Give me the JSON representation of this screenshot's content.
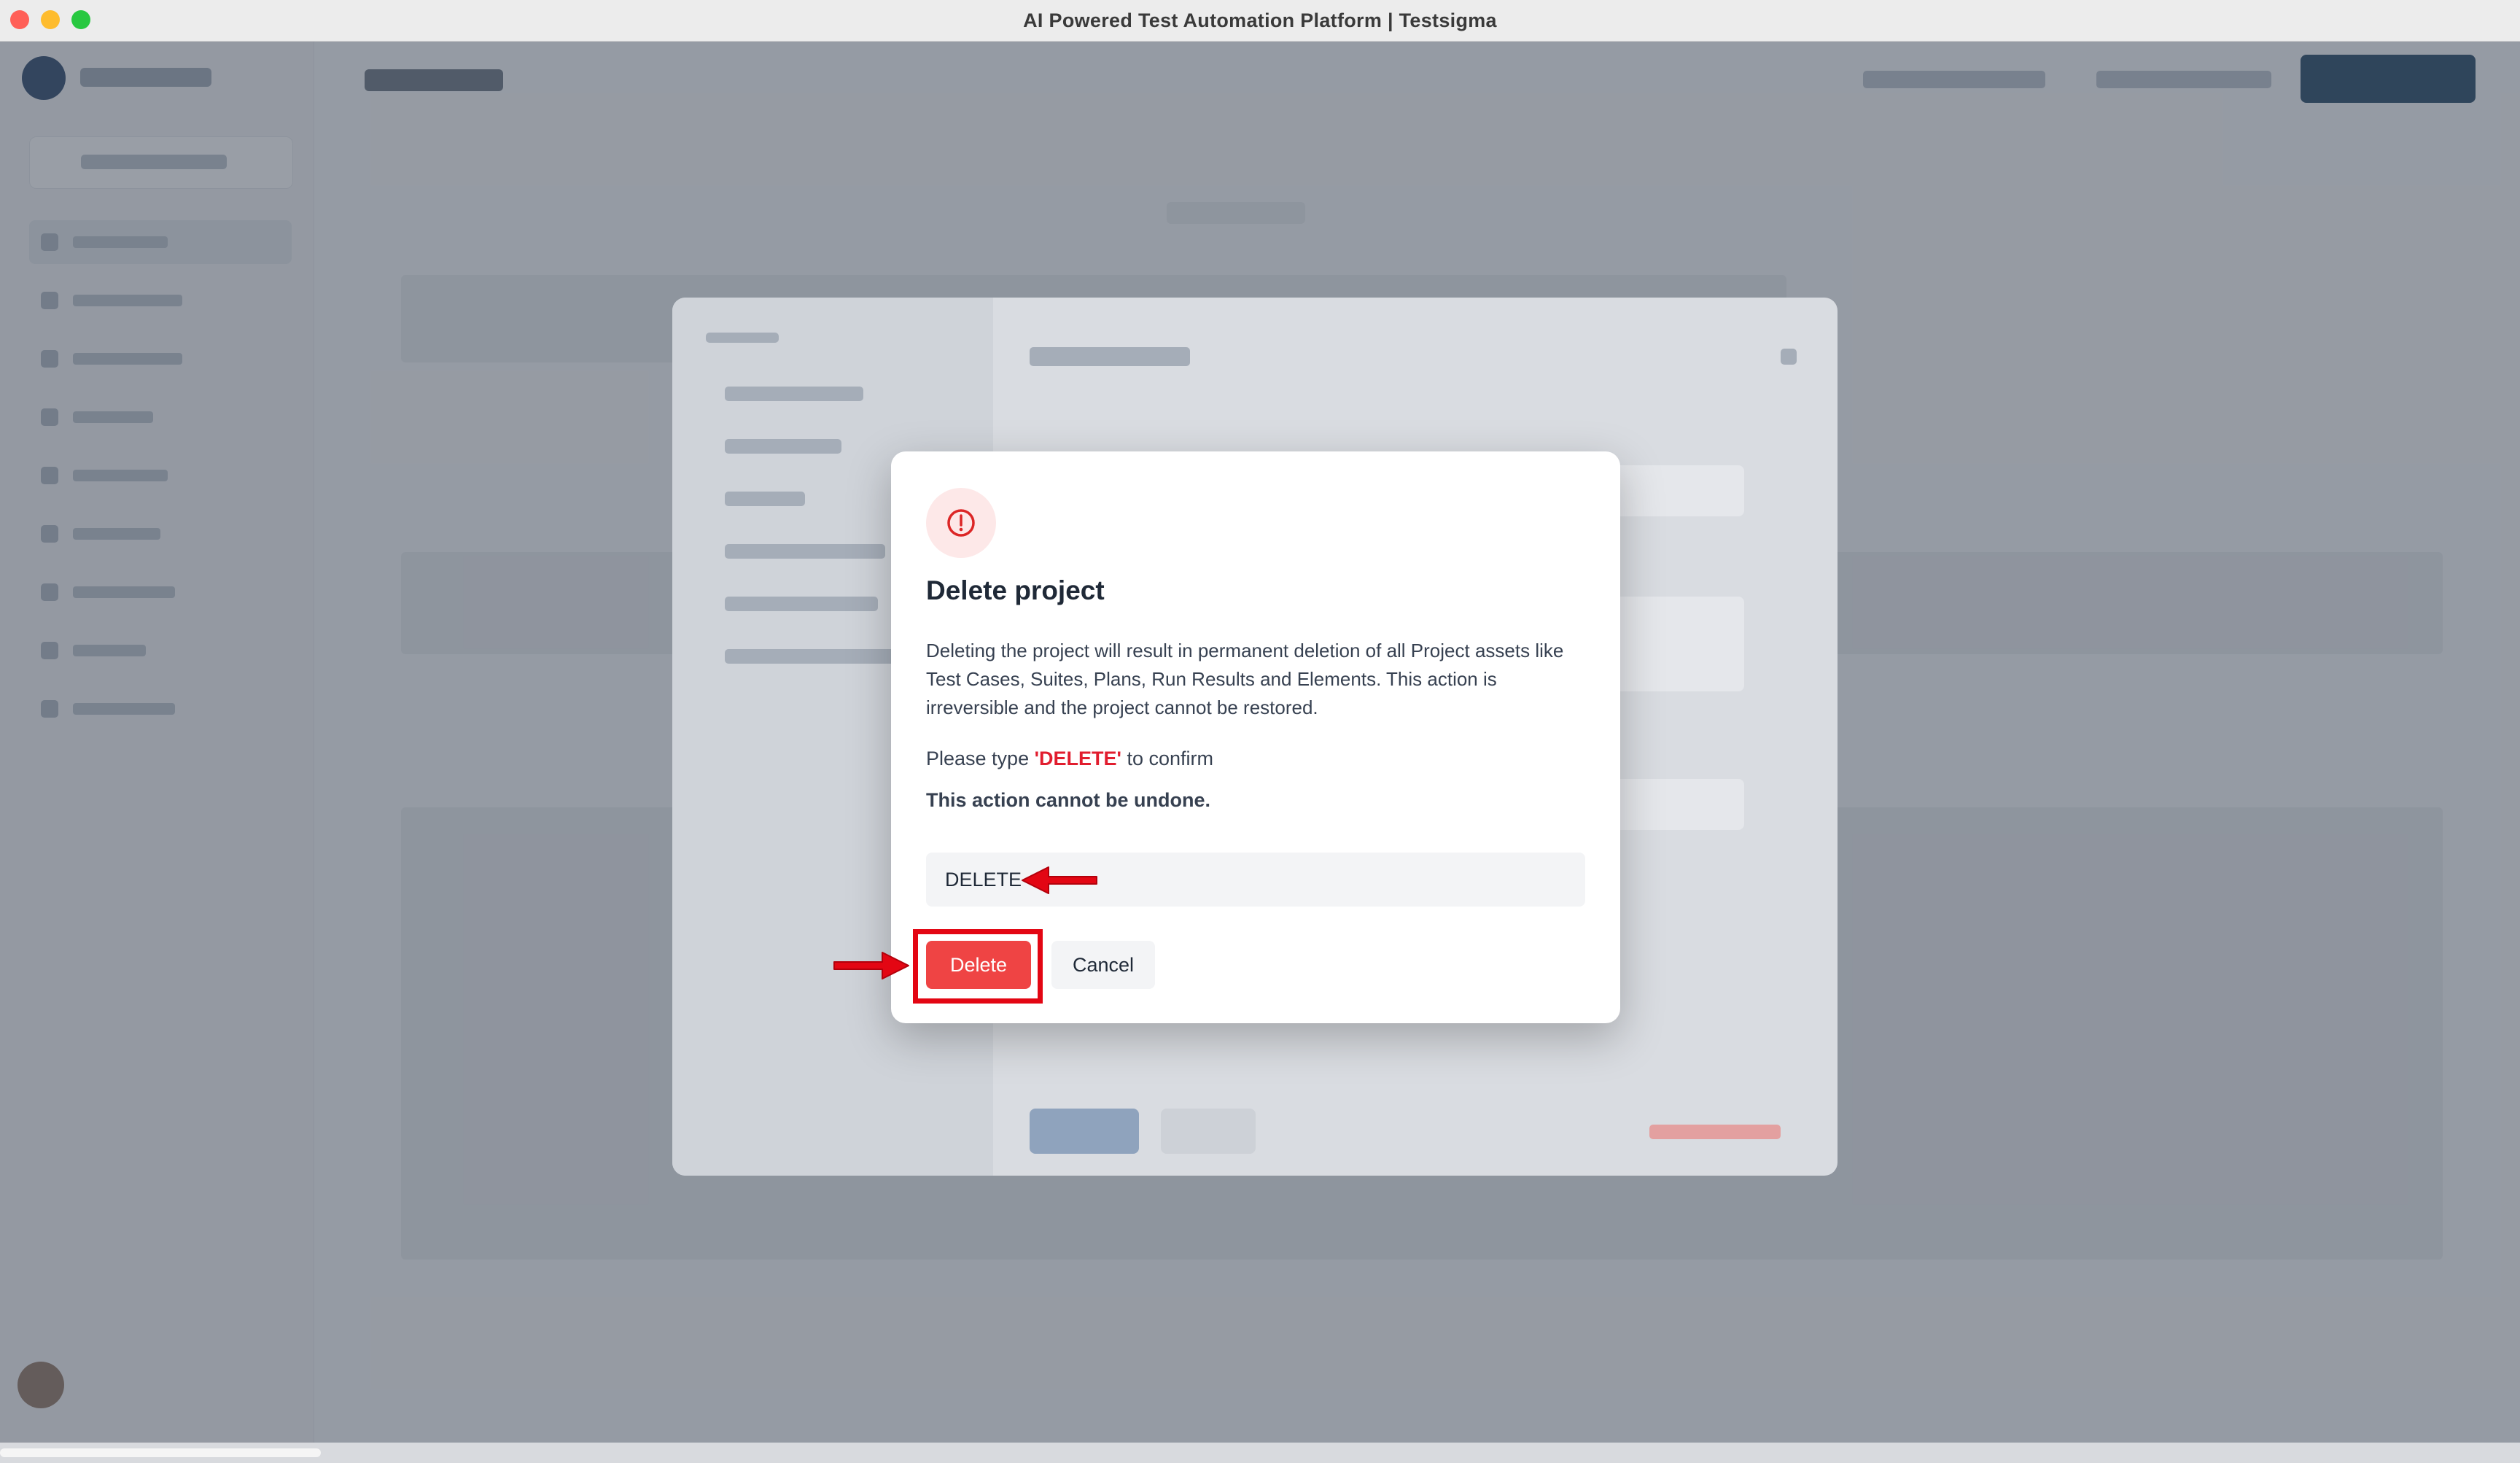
{
  "window": {
    "title": "AI Powered Test Automation Platform | Testsigma"
  },
  "dialog": {
    "title": "Delete project",
    "description": "Deleting the project will result in permanent deletion of all Project assets like Test Cases, Suites, Plans, Run Results and Elements. This action is irreversible and the project cannot be restored.",
    "confirm_prefix": "Please type ",
    "confirm_word": "'DELETE'",
    "confirm_suffix": " to confirm",
    "warning": "This action cannot be undone.",
    "input_value": "DELETE",
    "delete_label": "Delete",
    "cancel_label": "Cancel"
  },
  "colors": {
    "danger": "#ef4444",
    "annotation_red": "#e30613",
    "brand_dark": "#163a5a"
  },
  "icons": {
    "dialog_icon": "alert-circle-icon",
    "annotations": [
      "arrow-left-icon",
      "arrow-right-icon"
    ]
  }
}
